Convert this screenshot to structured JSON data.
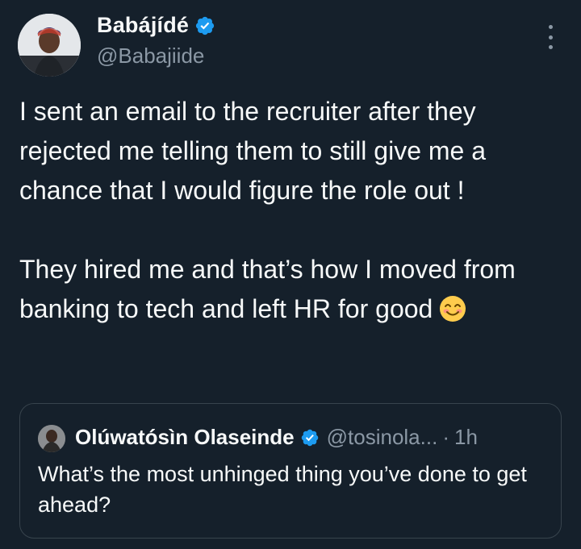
{
  "author": {
    "display_name": "Babájídé",
    "handle": "@Babajiide"
  },
  "tweet": {
    "text": "I sent an email to the recruiter after they rejected me telling them to still give me a chance that I would figure the role out !\n\nThey hired me and that’s how I moved from banking to tech and left HR for good"
  },
  "quoted_tweet": {
    "display_name": "Olúwatósìn Olaseinde",
    "handle": "@tosinola...",
    "separator": "·",
    "time": "1h",
    "text": "What’s the most unhinged thing you’ve done to get ahead?"
  },
  "icons": {
    "verified": "verified-badge-icon",
    "more": "more-options-icon",
    "emoji": "smiling-face-emoji"
  },
  "colors": {
    "background": "#15202b",
    "verified": "#1d9bf0",
    "secondary_text": "#8b98a5",
    "border": "#38444d"
  }
}
